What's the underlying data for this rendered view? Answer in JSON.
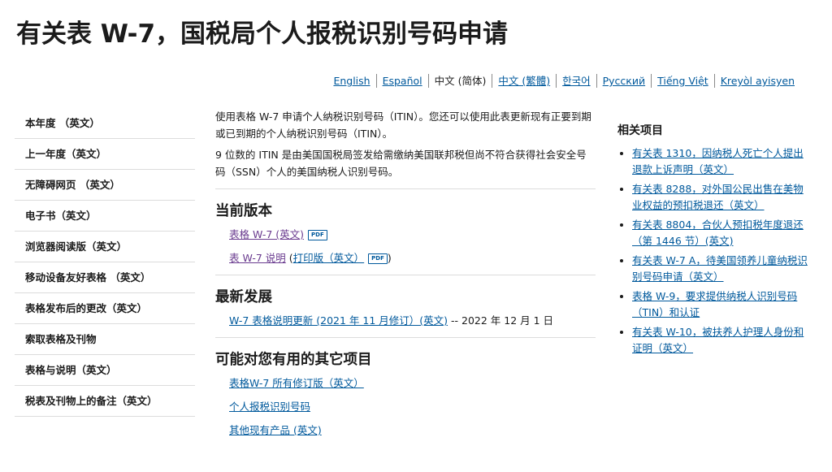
{
  "page": {
    "title": "有关表 W-7，国税局个人报税识别号码申请"
  },
  "languages": [
    {
      "label": "English",
      "current": false
    },
    {
      "label": "Español",
      "current": false
    },
    {
      "label": "中文 (简体)",
      "current": true
    },
    {
      "label": "中文 (繁體)",
      "current": false
    },
    {
      "label": "한국어",
      "current": false
    },
    {
      "label": "Русский",
      "current": false
    },
    {
      "label": "Tiếng Việt",
      "current": false
    },
    {
      "label": "Kreyòl ayisyen",
      "current": false
    }
  ],
  "sidebar": {
    "items": [
      {
        "label": "本年度 （英文）"
      },
      {
        "label": "上一年度（英文）"
      },
      {
        "label": "无障碍网页 （英文）"
      },
      {
        "label": "电子书（英文）"
      },
      {
        "label": "浏览器阅读版（英文）"
      },
      {
        "label": "移动设备友好表格 （英文）"
      },
      {
        "label": "表格发布后的更改（英文）"
      },
      {
        "label": "索取表格及刊物"
      },
      {
        "label": "表格与说明（英文）"
      },
      {
        "label": "税表及刊物上的备注（英文）"
      }
    ]
  },
  "main": {
    "intro_1": "使用表格 W-7 申请个人纳税识别号码（ITIN）。您还可以使用此表更新现有正要到期或已到期的个人纳税识别号码（ITIN）。",
    "intro_2": "9 位数的 ITIN 是由美国国税局签发给需缴纳美国联邦税但尚不符合获得社会安全号码（SSN）个人的美国纳税人识别号码。",
    "current_version": {
      "heading": "当前版本",
      "form_link": "表格 W-7 (英文)",
      "instructions_link": "表 W-7 说明",
      "paren_open": "(",
      "print_link": "打印版（英文）",
      "paren_close": ")",
      "pdf_label": "PDF"
    },
    "recent": {
      "heading": "最新发展",
      "update_link": "W-7 表格说明更新 (2021 年 11 月修订）(英文)",
      "update_date": " -- 2022 年 12 月 1 日"
    },
    "other": {
      "heading": "可能对您有用的其它项目",
      "links": [
        {
          "label": "表格W-7 所有修订版（英文）"
        },
        {
          "label": "个人报税识别号码"
        },
        {
          "label": "其他现有产品 (英文)"
        }
      ]
    }
  },
  "related": {
    "heading": "相关项目",
    "items": [
      {
        "label": "有关表 1310，因纳税人死亡个人提出退款上诉声明（英文）"
      },
      {
        "label": "有关表 8288，对外国公民出售在美物业权益的预扣税退还（英文）"
      },
      {
        "label": "有关表 8804，合伙人预扣税年度退还（第 1446 节）(英文)"
      },
      {
        "label": "有关表 W-7 A，待美国领养儿童纳税识别号码申请（英文）"
      },
      {
        "label": "表格 W-9，要求提供纳税人识别号码（TIN）和认证"
      },
      {
        "label": "有关表 W-10，被扶养人护理人身份和证明（英文）"
      }
    ]
  },
  "colors": {
    "link": "#00599c",
    "visited": "#6a3b8f",
    "text": "#1b1b1b",
    "divider": "#dcdcdc"
  }
}
